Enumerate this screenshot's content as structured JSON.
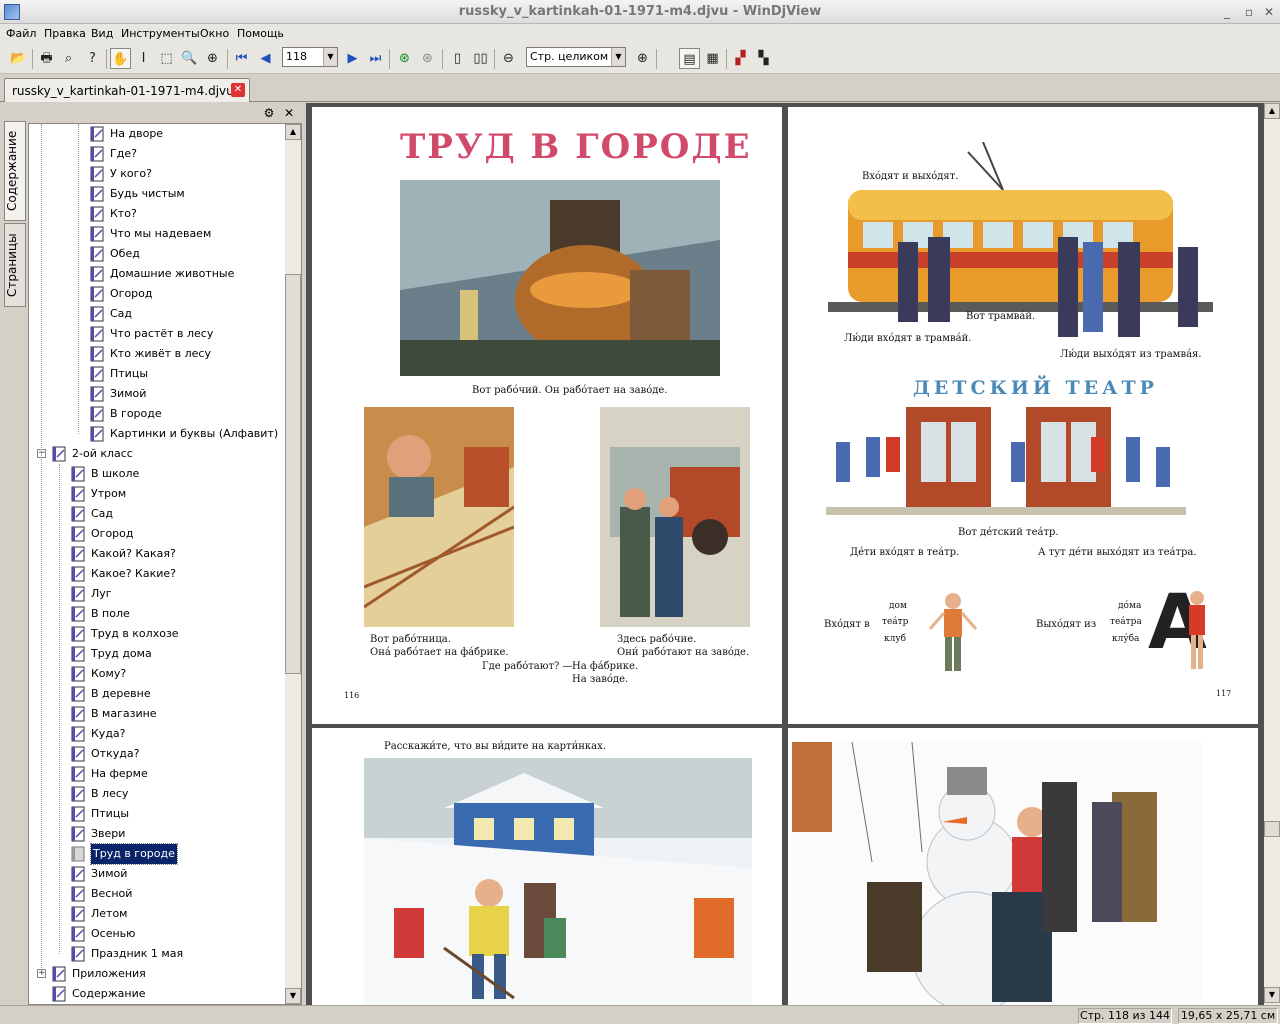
{
  "window": {
    "title": "russky_v_kartinkah-01-1971-m4.djvu - WinDjView",
    "minimize_glyph": "_",
    "maximize_glyph": "▫",
    "close_glyph": "✕"
  },
  "menu": [
    "Файл",
    "Правка",
    "Вид",
    "Инструменты",
    "Окно",
    "Помощь"
  ],
  "toolbar": {
    "page_number": "118",
    "zoom_value": "Стр. целиком",
    "icons": [
      "open-icon",
      "print-icon",
      "find-icon",
      "help-icon",
      "hand-tool-icon",
      "text-select-icon",
      "rect-select-icon",
      "zoom-in-tool-icon",
      "zoom-rect-icon",
      "first-page-icon",
      "prev-page-icon",
      "next-page-icon",
      "last-page-icon",
      "back-icon",
      "forward-icon",
      "single-page-icon",
      "two-page-icon",
      "zoom-out-icon",
      "zoom-in-icon",
      "one-page-view-icon",
      "continuous-view-icon",
      "rotate-left-icon",
      "rotate-right-icon"
    ]
  },
  "document_tab": {
    "label": "russky_v_kartinkah-01-1971-m4.djvu"
  },
  "sidebar": {
    "tabs": [
      "Содержание",
      "Страницы"
    ],
    "tree_level2": [
      "На дворе",
      "Где?",
      "У кого?",
      "Будь чистым",
      "Кто?",
      "Что мы надеваем",
      "Обед",
      "Домашние животные",
      "Огород",
      "Сад",
      "Что растёт в лесу",
      "Кто живёт в лесу",
      "Птицы",
      "Зимой",
      "В городе",
      "Картинки и буквы (Алфавит)"
    ],
    "class2_label": "2-ой класс",
    "class2_items": [
      "В школе",
      "Утром",
      "Сад",
      "Огород",
      "Какой? Какая?",
      "Какое? Какие?",
      "Луг",
      "В поле",
      "Труд в колхозе",
      "Труд дома",
      "Кому?",
      "В деревне",
      "В магазине",
      "Куда?",
      "Откуда?",
      "На ферме",
      "В лесу",
      "Птицы",
      "Звери",
      "Труд в городе",
      "Зимой",
      "Весной",
      "Летом",
      "Осенью",
      "Праздник 1 мая"
    ],
    "selected_item": "Труд в городе",
    "appendix_label": "Приложения",
    "contents_label": "Содержание"
  },
  "page116": {
    "title": "ТРУД В ГОРОДЕ",
    "caption1": "Вот рабо́чий. Он рабо́тает на заво́де.",
    "caption2a": "Вот рабо́тница.",
    "caption2b": "Она́ рабо́тает на фа́брике.",
    "caption3a": "Здесь рабо́чие.",
    "caption3b": "Они́ рабо́тают на заво́де.",
    "question": "Где рабо́тают? —",
    "answer1": "На фа́брике.",
    "answer2": "На заво́де.",
    "page_num": "116"
  },
  "page117": {
    "caption_top": "Вхо́дят и выхо́дят.",
    "tram_caption": "Вот трамва́й.",
    "people_in": "Лю́ди вхо́дят в трамва́й.",
    "people_out": "Лю́ди выхо́дят из трамва́я.",
    "theatre_title": "ДЕТСКИЙ ТЕАТР",
    "theatre_caption": "Вот де́тский теа́тр.",
    "kids_in": "Де́ти вхо́дят в теа́тр.",
    "kids_out": "А тут де́ти выхо́дят из теа́тра.",
    "vkhodyat_v": "Вхо́дят в",
    "vykhodyat_iz": "Выхо́дят из",
    "w1": "дом",
    "w2": "теа́тр",
    "w3": "клуб",
    "w4": "до́ма",
    "w5": "теа́тра",
    "w6": "клу́ба",
    "big_letter": "А",
    "page_num": "117"
  },
  "page118": {
    "caption": "Расскажи́те, что вы ви́дите на карти́нках."
  },
  "status": {
    "page_info": "Стр. 118 из 144",
    "page_size": "19,65 x 25,71 см"
  }
}
